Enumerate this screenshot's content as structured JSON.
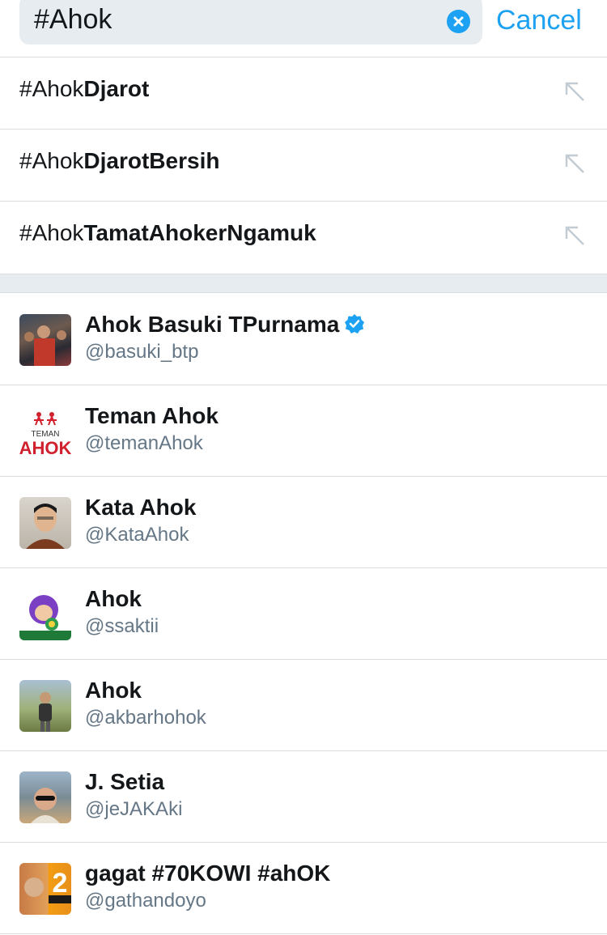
{
  "search": {
    "query": "#Ahok",
    "cancel_label": "Cancel"
  },
  "suggestions": [
    {
      "typed": "#Ahok",
      "rest": "Djarot"
    },
    {
      "typed": "#Ahok",
      "rest": "DjarotBersih"
    },
    {
      "typed": "#Ahok",
      "rest": "TamatAhokerNgamuk"
    }
  ],
  "users": [
    {
      "name": "Ahok Basuki TPurnama",
      "handle": "@basuki_btp",
      "verified": true
    },
    {
      "name": "Teman Ahok",
      "handle": "@temanAhok",
      "verified": false
    },
    {
      "name": "Kata Ahok",
      "handle": "@KataAhok",
      "verified": false
    },
    {
      "name": "Ahok",
      "handle": "@ssaktii",
      "verified": false
    },
    {
      "name": "Ahok",
      "handle": "@akbarhohok",
      "verified": false
    },
    {
      "name": "J. Setia",
      "handle": "@jeJAKAki",
      "verified": false
    },
    {
      "name": "gagat #70KOWI #ahOK",
      "handle": "@gathandoyo",
      "verified": false
    }
  ],
  "avatar_logo": {
    "teman_line1": "TEMAN",
    "teman_line2": "AHOK",
    "gagat_number": "2"
  },
  "colors": {
    "accent": "#1da1f2",
    "text": "#14171a",
    "secondary": "#657786",
    "divider": "#d8dde1",
    "field_bg": "#e6ecf0",
    "brand_red": "#d0202e"
  }
}
